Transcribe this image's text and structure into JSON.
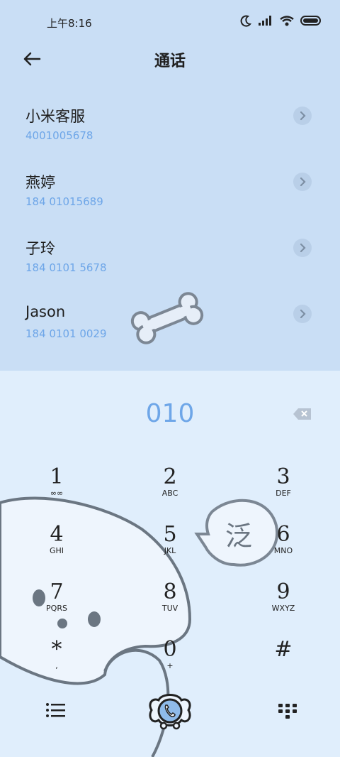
{
  "status": {
    "time": "上午8:16"
  },
  "header": {
    "title": "通话"
  },
  "contacts": [
    {
      "name": "小米客服",
      "number": "4001005678"
    },
    {
      "name": "燕婷",
      "number": "184 01015689"
    },
    {
      "name": "子玲",
      "number": "184 0101 5678"
    },
    {
      "name": "Jason",
      "number": "184 0101 0029"
    }
  ],
  "dialer": {
    "input": "010"
  },
  "keypad": [
    {
      "digit": "1",
      "letters": "∞∞"
    },
    {
      "digit": "2",
      "letters": "ABC"
    },
    {
      "digit": "3",
      "letters": "DEF"
    },
    {
      "digit": "4",
      "letters": "GHI"
    },
    {
      "digit": "5",
      "letters": "JKL"
    },
    {
      "digit": "6",
      "letters": "MNO"
    },
    {
      "digit": "7",
      "letters": "PQRS"
    },
    {
      "digit": "8",
      "letters": "TUV"
    },
    {
      "digit": "9",
      "letters": "WXYZ"
    },
    {
      "digit": "*",
      "letters": ","
    },
    {
      "digit": "0",
      "letters": "+"
    },
    {
      "digit": "#",
      "letters": ""
    }
  ],
  "decor": {
    "bubble_char": "泛"
  },
  "colors": {
    "accent": "#6ea6e8",
    "top_bg": "#c9def5",
    "bottom_bg": "#e0eefc"
  }
}
